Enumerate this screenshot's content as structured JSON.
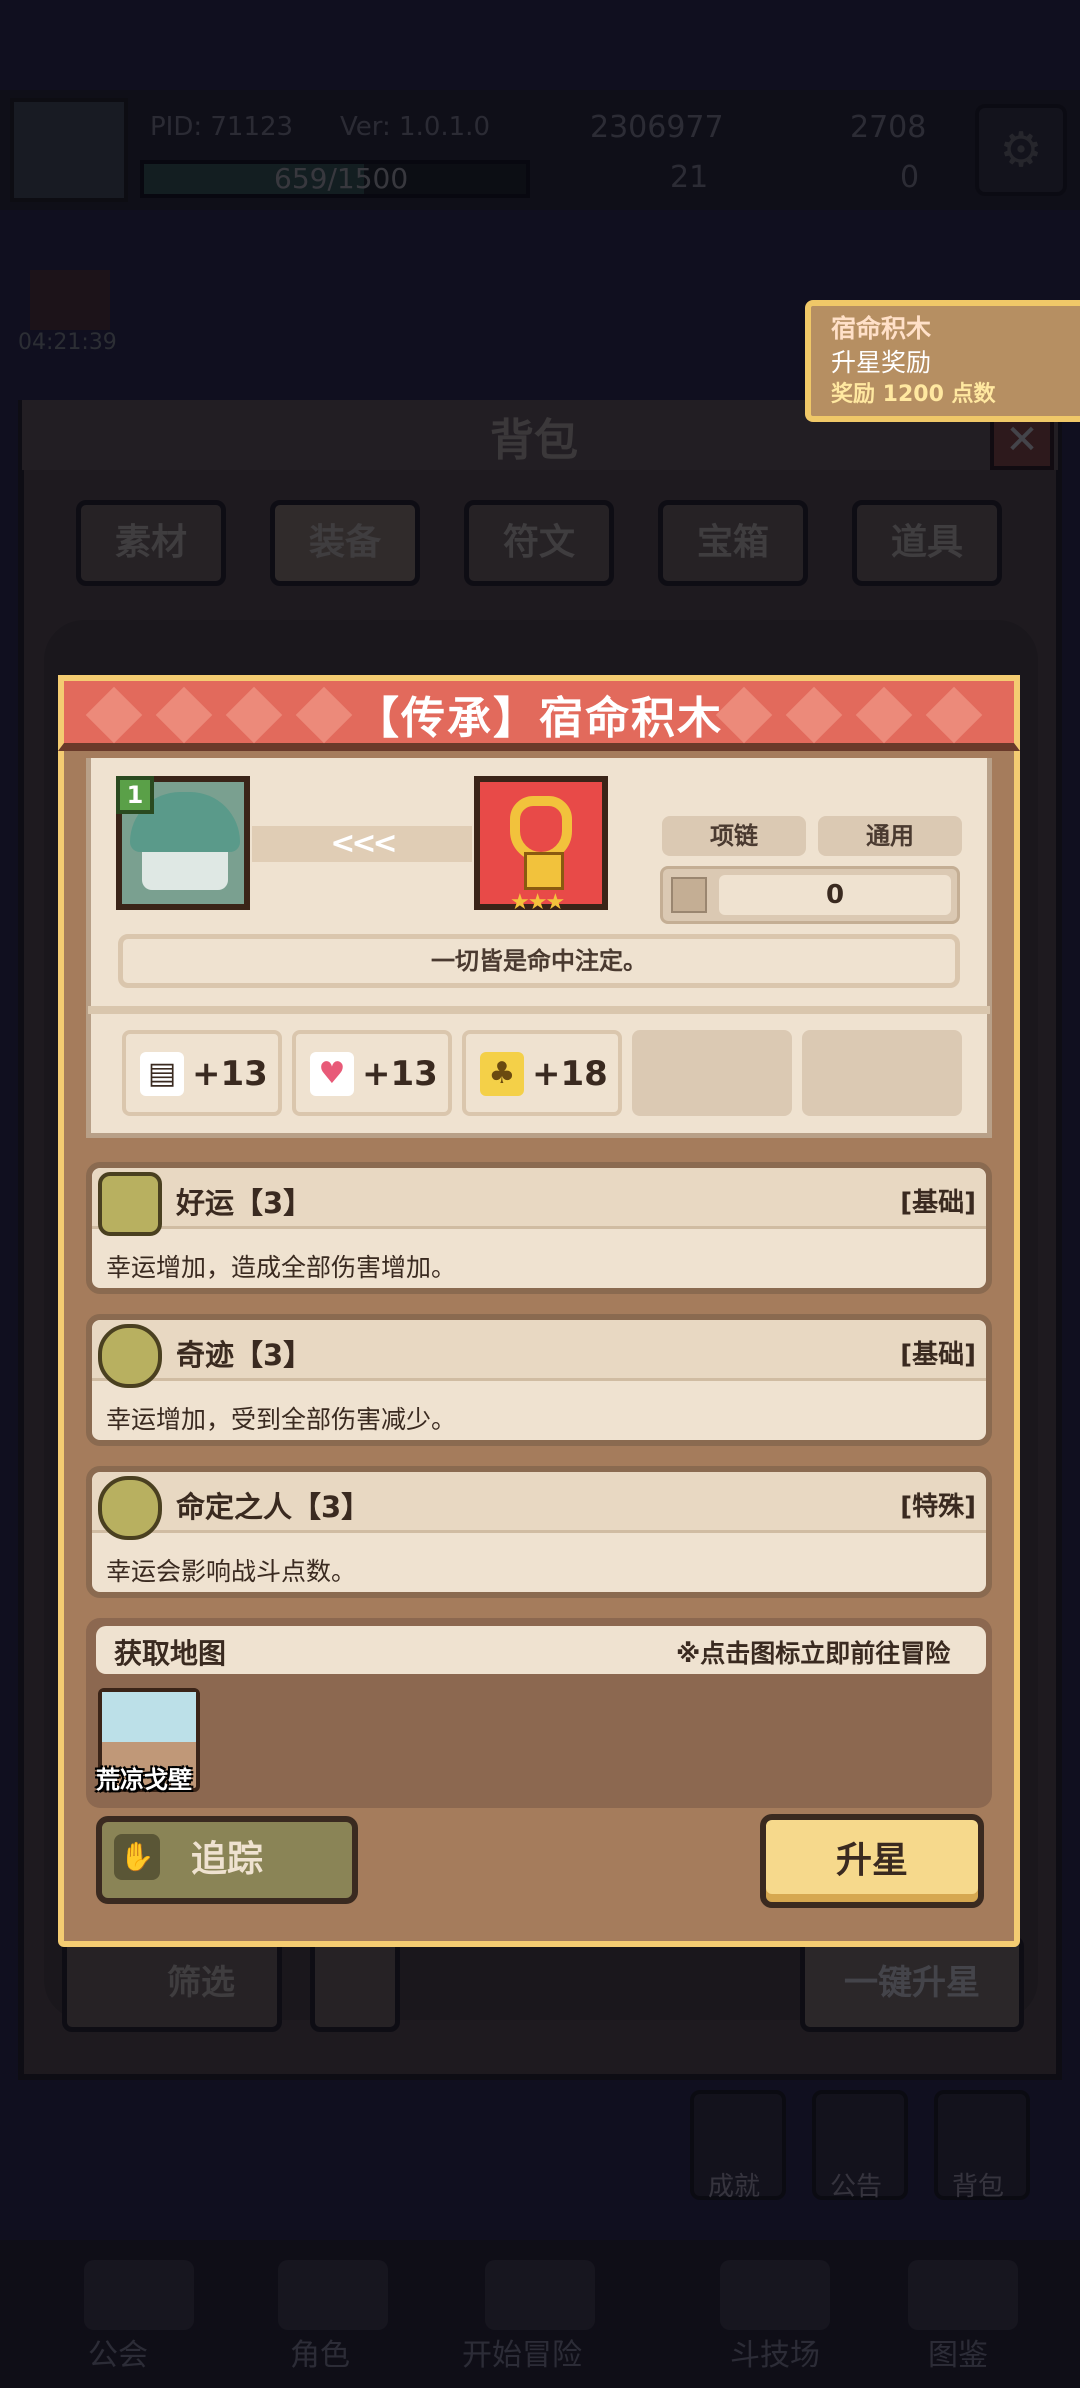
{
  "topbar": {
    "pid": "PID: 71123",
    "version": "Ver: 1.0.1.0",
    "xp": "659/1500",
    "gold": "2306977",
    "gems": "2708",
    "res3": "21",
    "res4": "0"
  },
  "timer": "04:21:39",
  "toast": {
    "title": "宿命积木",
    "subtitle": "升星奖励",
    "reward": "奖励 1200 点数"
  },
  "bag": {
    "title": "背包",
    "close": "✕",
    "tabs": [
      "素材",
      "装备",
      "符文",
      "宝箱",
      "道具"
    ],
    "filter": "筛选",
    "one_key_star": "一键升星"
  },
  "bottom": {
    "nav": [
      "公会",
      "角色",
      "开始冒险",
      "斗技场",
      "图鉴"
    ],
    "side": [
      "成就",
      "公告",
      "背包"
    ]
  },
  "modal": {
    "title": "【传承】宿命积木",
    "level": "1",
    "arrows": "<<<",
    "stars": "★★★",
    "tags": [
      "项链",
      "通用"
    ],
    "count": "0",
    "description": "一切皆是命中注定。",
    "stats": [
      {
        "icon": "book-icon",
        "value": "+13"
      },
      {
        "icon": "heart-icon",
        "value": "+13"
      },
      {
        "icon": "clover-icon",
        "value": "+18"
      }
    ],
    "skills": [
      {
        "name": "好运【3】",
        "type": "[基础]",
        "desc": "幸运增加，造成全部伤害增加。"
      },
      {
        "name": "奇迹【3】",
        "type": "[基础]",
        "desc": "幸运增加，受到全部伤害减少。"
      },
      {
        "name": "命定之人【3】",
        "type": "[特殊]",
        "desc": "幸运会影响战斗点数。"
      }
    ],
    "map": {
      "title": "获取地图",
      "hint": "※点击图标立即前往冒险",
      "location": "荒凉戈壁"
    },
    "track_button": "追踪",
    "star_button": "升星"
  }
}
